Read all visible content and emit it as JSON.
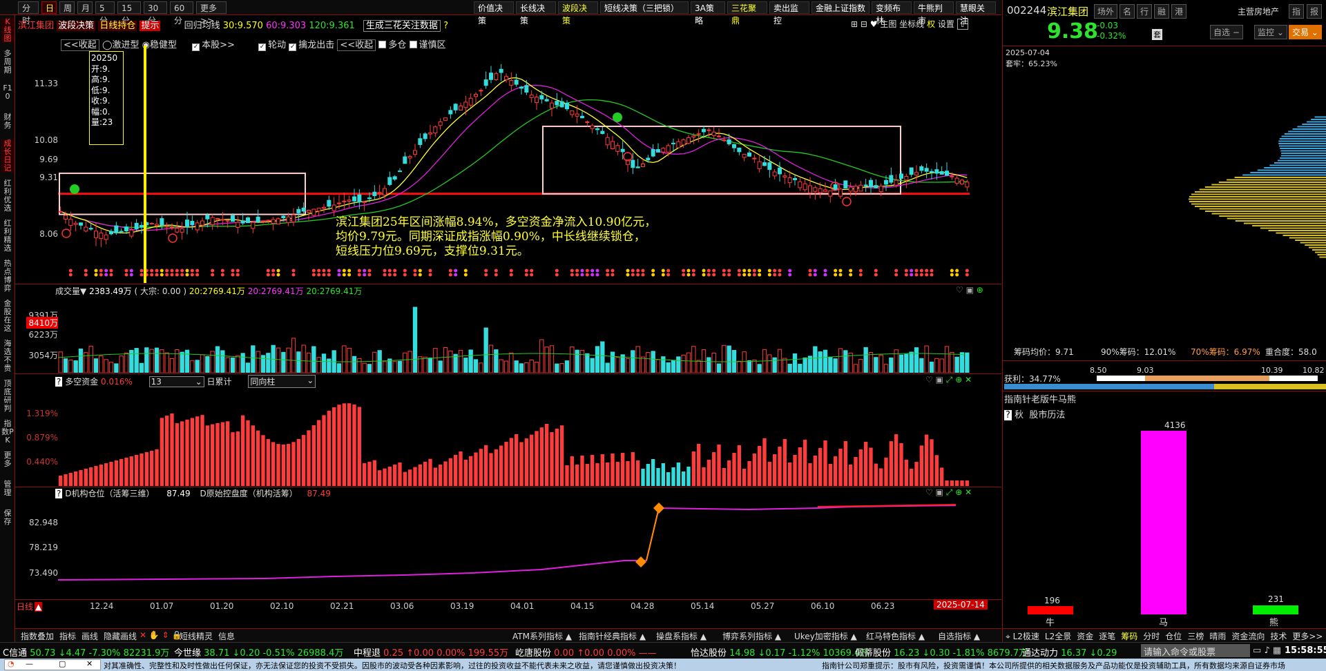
{
  "period_tabs": [
    "分时",
    "日",
    "周",
    "月",
    "5分",
    "15分",
    "30分",
    "60分",
    "更多>>"
  ],
  "active_period": "日",
  "func_tabs": [
    "价值决策",
    "长线决策",
    "波段决策",
    "短线决策（三把锁）",
    "3A策略",
    "三花聚鼎",
    "卖出监控",
    "金融上证指数",
    "变频布林",
    "牛熊判市",
    "慧眼关注"
  ],
  "left_nav": [
    "K线图",
    "多周期",
    "F10",
    "财务",
    "成长日记",
    "红利优选",
    "红利精选",
    "热点博弈",
    "金股在这",
    "海选不贵",
    "顶底研判",
    "指数PK",
    "更多",
    "管理",
    "保存"
  ],
  "main_header": {
    "stock": "滨江集团",
    "tabs": [
      "波段决策",
      "日线持仓"
    ],
    "hint": "提示",
    "ma_label": "回归均线",
    "ma30": "30:9.570",
    "ma60": "60:9.303",
    "ma120": "120:9.361",
    "gen_btn": "生成三花关注数据",
    "right_items": [
      "主图",
      "坐标线",
      "权",
      "设置"
    ]
  },
  "options_bar": {
    "collapse1": "<<收起",
    "radio1": "激进型",
    "radio2": "稳健型",
    "check1": "本股>>",
    "check2": "轮动",
    "check3": "擒龙出击",
    "collapse2": "<<收起",
    "check4": "多仓",
    "check5": "谨慎区"
  },
  "price_axis": [
    "11.33",
    "10.08",
    "9.69",
    "9.31",
    "8.06"
  ],
  "tooltip": {
    "date": "20250",
    "lines": [
      "开:9.",
      "高:9.",
      "低:9.",
      "收:9.",
      "幅:0.",
      "量:23"
    ]
  },
  "annotation": [
    "滨江集团25年区间涨幅8.94%，多空资金净流入10.90亿元，",
    "均价9.79元。同期深证成指涨幅0.90%，中长线继续锁仓，",
    "短线压力位9.69元，支撑位9.31元。"
  ],
  "volume_header": {
    "label": "成交量▼",
    "value": "2383.49万",
    "big": "( 大宗: 0.00 )",
    "ma1": "20:2769.41万",
    "ma2": "20:2769.41万",
    "ma3": "20:2769.41万"
  },
  "volume_axis": [
    "9391万",
    "8410万",
    "6223万",
    "3054万"
  ],
  "money_header": {
    "label": "多空资金",
    "value": "0.016%",
    "select": "13",
    "accum": "日累计",
    "mode": "同向柱"
  },
  "money_axis": [
    "1.319%",
    "0.879%",
    "0.440%"
  ],
  "inst_header": {
    "label": "D机构仓位（活筹三维）",
    "value": "87.49",
    "label2": "D原始控盘度（机构活筹）",
    "value2": "87.49"
  },
  "inst_axis": [
    "82.948",
    "78.219",
    "73.490"
  ],
  "date_axis": [
    "12.24",
    "01.07",
    "01.20",
    "02.10",
    "02.21",
    "03.06",
    "03.19",
    "04.01",
    "04.15",
    "04.28",
    "05.14",
    "05.27",
    "06.10",
    "06.23"
  ],
  "date_current": "2025-07-14",
  "date_axis_label": "日线",
  "bottom_tools": [
    "指数叠加",
    "指标",
    "画线",
    "隐藏画线",
    "短线精灵",
    "信息"
  ],
  "bottom_series": [
    "ATM系列指标 ▲",
    "指南针经典指标 ▲",
    "操盘系指标 ▲",
    "博弈系列指标 ▲",
    "Ukey加密指标 ▲",
    "红马特色指标 ▲",
    "自选指标 ▲"
  ],
  "right_panel": {
    "code": "002244",
    "name": "滨江集团",
    "tabs": [
      "场外",
      "名",
      "行",
      "融",
      "港"
    ],
    "sector": "主营房地产",
    "btn_zhi": "指",
    "btn_bao": "报",
    "price": "9.38",
    "change": "-0.03",
    "pct": "-0.32%",
    "tao": "套",
    "zixuan": "自选 −",
    "jiankong": "监控 ⌄",
    "trade": "交易 ⌄",
    "date": "2025-07-04",
    "taolao": "套牢：65.23%",
    "avg_cost": "筹码均价：9.71",
    "c90": "90%筹码：12.01%",
    "c70": "70%筹码：6.97%",
    "overlap": "重合度：58.0",
    "profit": "获利：34.77%",
    "scale": [
      "8.50",
      "9.03",
      "10.39",
      "10.82"
    ],
    "bull_title": "指南针老版牛马熊",
    "qiu": "秋",
    "market": "股市历法",
    "bull": "196",
    "horse": "4136",
    "bear": "231",
    "bull_label": "牛",
    "horse_label": "马",
    "bear_label": "熊"
  },
  "right_tabs": [
    "L2极速",
    "L2全景",
    "资金",
    "逐笔",
    "筹码",
    "分时",
    "仓位",
    "三榜",
    "晴雨",
    "资金流向",
    "技术",
    "更多>>"
  ],
  "tickers": [
    {
      "name": "今世缘",
      "v": "38.71 ↓0.20 -0.51% 26988.4万"
    },
    {
      "name": "中程退",
      "v": "0.25 ↑0.00 0.00% 199.55万"
    },
    {
      "name": "屹唐股份",
      "v": "0.00 ↑0.00 0.00% ——"
    },
    {
      "name": "恰达股份",
      "v": "14.98 ↓0.17 -1.12% 10369.4万"
    },
    {
      "name": "佩蒂股份",
      "v": "16.23 ↓0.30 -1.81% 8679.7万"
    },
    {
      "name": "通达动力",
      "v": "16.37 ↓0.29"
    }
  ],
  "ticker_first": "50.73 ↓4.47 -7.30% 82231.9万",
  "ticker_first_name": "C信通",
  "command_placeholder": "请输入命令或股票",
  "clock": "15:58:55",
  "status_text": "对其准确性、完整性和及时性做出任何保证，亦无法保证您的投资不受损失。因股市的波动受各种因素影响，过往的投资收益不能代表未来之收益，请您谨慎做出投资决策！",
  "status_right": "指南针公司郑重提示：股市有风险，投资需谨慎！本公司所提供的相关数据服务及产品功能仅是投资辅助工具，所有数据均来源自证券市场",
  "colors": {
    "up": "#ff3b3b",
    "down": "#33dddd",
    "ma_yellow": "#ffff33",
    "ma_mag": "#e020e0",
    "ma_green": "#22cc22",
    "border": "#8b1010"
  },
  "chart_data": {
    "type": "candlestick",
    "series": [
      {
        "name": "K",
        "values": [
          8.9,
          8.7,
          8.6,
          8.5,
          8.55,
          8.6,
          8.7,
          8.65,
          8.6,
          8.7,
          8.8,
          8.75,
          8.7,
          8.72,
          8.76,
          8.8,
          8.9,
          8.95,
          9.0,
          9.1,
          9.05,
          9.2,
          9.4,
          9.8,
          10.1,
          10.4,
          10.6,
          10.8,
          11.0,
          11.3,
          11.1,
          10.9,
          10.8,
          10.7,
          10.6,
          10.4,
          10.2,
          10.0,
          9.6,
          9.8,
          10.0,
          10.1,
          10.2,
          10.3,
          10.1,
          9.9,
          9.8,
          9.6,
          9.5,
          9.4,
          9.3,
          9.25,
          9.3,
          9.35,
          9.3,
          9.4,
          9.5,
          9.6,
          9.55,
          9.5,
          9.4
        ]
      }
    ],
    "ylim": [
      8.0,
      11.6
    ],
    "xlabel": "",
    "ylabel": ""
  }
}
